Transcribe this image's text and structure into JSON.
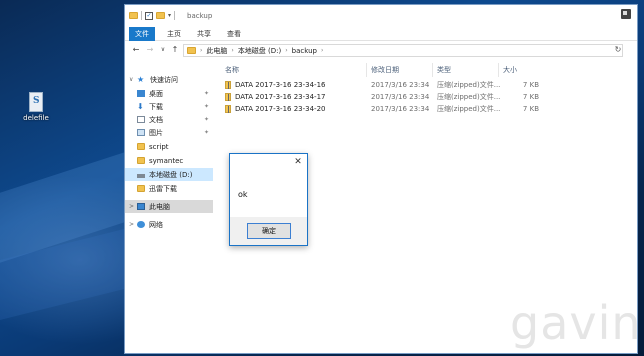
{
  "desktop": {
    "icon_label": "delefile"
  },
  "window": {
    "title": "backup",
    "ribbon_tabs": [
      {
        "label": "文件",
        "active": true
      },
      {
        "label": "主页",
        "active": false
      },
      {
        "label": "共享",
        "active": false
      },
      {
        "label": "查看",
        "active": false
      }
    ],
    "nav_buttons": {
      "back": "←",
      "forward": "→",
      "recent": "∨",
      "up": "↑",
      "refresh": "↻"
    },
    "breadcrumb": [
      "此电脑",
      "本地磁盘 (D:)",
      "backup"
    ],
    "sidebar": [
      {
        "label": "快速访问",
        "icon": "star-icon",
        "expand": "∨",
        "pinned": false
      },
      {
        "label": "桌面",
        "icon": "desktop-icon",
        "expand": "",
        "pinned": true
      },
      {
        "label": "下载",
        "icon": "download-icon",
        "expand": "",
        "pinned": true
      },
      {
        "label": "文档",
        "icon": "document-icon",
        "expand": "",
        "pinned": true
      },
      {
        "label": "图片",
        "icon": "picture-icon",
        "expand": "",
        "pinned": true
      },
      {
        "label": "script",
        "icon": "folder-icon",
        "expand": "",
        "pinned": false
      },
      {
        "label": "symantec",
        "icon": "folder-icon",
        "expand": "",
        "pinned": false
      },
      {
        "label": "本地磁盘 (D:)",
        "icon": "drive-icon",
        "expand": "",
        "pinned": false
      },
      {
        "label": "迅雷下载",
        "icon": "folder-icon",
        "expand": "",
        "pinned": false
      },
      {
        "label": "此电脑",
        "icon": "pc-icon",
        "expand": ">",
        "pinned": false
      },
      {
        "label": "网络",
        "icon": "network-icon",
        "expand": ">",
        "pinned": false
      }
    ],
    "columns": [
      "名称",
      "修改日期",
      "类型",
      "大小"
    ],
    "files": [
      {
        "name": "DATA 2017-3-16 23-34-16",
        "modified": "2017/3/16 23:34",
        "type": "压缩(zipped)文件...",
        "size": "7 KB"
      },
      {
        "name": "DATA 2017-3-16 23-34-17",
        "modified": "2017/3/16 23:34",
        "type": "压缩(zipped)文件...",
        "size": "7 KB"
      },
      {
        "name": "DATA 2017-3-16 23-34-20",
        "modified": "2017/3/16 23:34",
        "type": "压缩(zipped)文件...",
        "size": "7 KB"
      }
    ]
  },
  "dialog": {
    "close": "✕",
    "message": "ok",
    "ok_button": "确定"
  },
  "watermark": "gavin",
  "colors": {
    "accent": "#1979ca",
    "selected": "#cce8ff",
    "folder": "#f1c24f"
  }
}
